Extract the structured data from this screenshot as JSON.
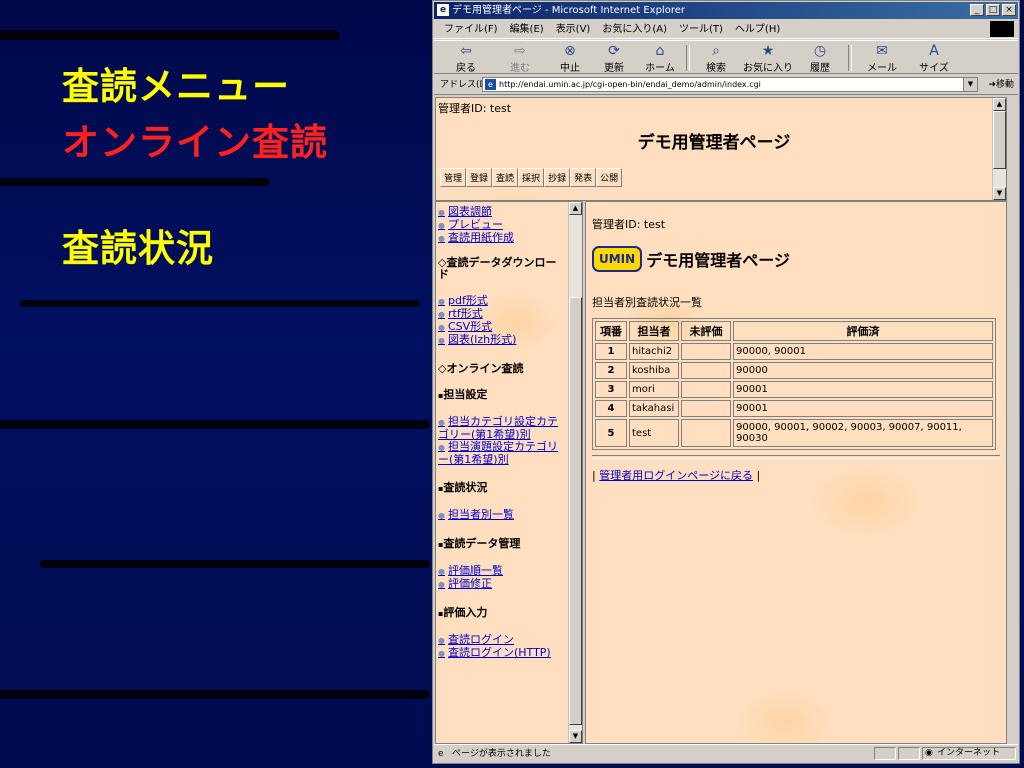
{
  "slide": {
    "line1": "査読メニュー",
    "line2": "オンライン査読",
    "line3": "査読状況",
    "color_yellow": "#ffff00",
    "color_red": "#ff2020"
  },
  "window": {
    "title": "デモ用管理者ページ - Microsoft Internet Explorer",
    "menu": [
      "ファイル(F)",
      "編集(E)",
      "表示(V)",
      "お気に入り(A)",
      "ツール(T)",
      "ヘルプ(H)"
    ],
    "toolbar": {
      "back": "戻る",
      "forward": "進む",
      "stop": "中止",
      "refresh": "更新",
      "home": "ホーム",
      "search": "検索",
      "favorites": "お気に入り",
      "history": "履歴",
      "mail": "メール",
      "size": "サイズ"
    },
    "address_label": "アドレス(D)",
    "address_url": "http://endai.umin.ac.jp/cgi-open-bin/endai_demo/admin/index.cgi",
    "go_label": "移動",
    "status_text": "ページが表示されました",
    "zone_text": "インターネット"
  },
  "top_frame": {
    "admin_id": "管理者ID: test",
    "title": "デモ用管理者ページ",
    "tabs": [
      "管理",
      "登録",
      "査読",
      "採択",
      "抄録",
      "発表",
      "公開"
    ]
  },
  "left_frame": {
    "links_top": [
      "図表調節",
      "プレビュー",
      "査読用紙作成"
    ],
    "download_head": "◇査読データダウンロード",
    "download_links": [
      "pdf形式",
      "rtf形式",
      "CSV形式",
      "図表(lzh形式)"
    ],
    "online_head": "◇オンライン査読",
    "assign_head": "担当設定",
    "assign_links": [
      "担当カテゴリ設定カテゴリー(第1希望)別",
      "担当演題設定カテゴリー(第1希望)別"
    ],
    "status_head": "査読状況",
    "status_links": [
      "担当者別一覧"
    ],
    "data_head": "査読データ管理",
    "data_links": [
      "評価順一覧",
      "評価修正"
    ],
    "input_head": "評価入力",
    "input_links": [
      "査読ログイン",
      "査読ログイン(HTTP)"
    ]
  },
  "right_frame": {
    "admin_id": "管理者ID: test",
    "logo": "UMIN",
    "title": "デモ用管理者ページ",
    "subtitle": "担当者別査読状況一覧",
    "headers": [
      "項番",
      "担当者",
      "未評価",
      "評価済"
    ],
    "rows": [
      {
        "no": "1",
        "name": "hitachi2",
        "pending": "",
        "done": "90000, 90001"
      },
      {
        "no": "2",
        "name": "koshiba",
        "pending": "",
        "done": "90000"
      },
      {
        "no": "3",
        "name": "mori",
        "pending": "",
        "done": "90001"
      },
      {
        "no": "4",
        "name": "takahasi",
        "pending": "",
        "done": "90001"
      },
      {
        "no": "5",
        "name": "test",
        "pending": "",
        "done": "90000, 90001, 90002, 90003, 90007, 90011, 90030"
      }
    ],
    "back_link": "管理者用ログインページに戻る"
  }
}
